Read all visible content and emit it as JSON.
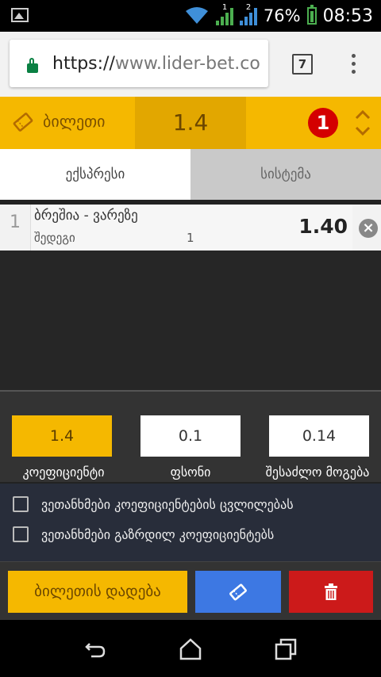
{
  "status_bar": {
    "battery_percent": "76%",
    "time": "08:53",
    "sim1_label": "1",
    "sim2_label": "2"
  },
  "browser": {
    "url_scheme": "https://",
    "url_rest": "www.lider-bet.co",
    "tab_count": "7"
  },
  "ticket": {
    "title": "ბილეთი",
    "total_coefficient": "1.4",
    "selection_count": "1"
  },
  "tabs": [
    {
      "label": "ექსპრესი",
      "active": true
    },
    {
      "label": "სისტემა",
      "active": false
    }
  ],
  "selections": [
    {
      "index": "1",
      "match": "ბრეშია - ვარეზე",
      "market": "შედეგი",
      "outcome": "1",
      "odds": "1.40"
    }
  ],
  "summary": {
    "coefficient_value": "1.4",
    "coefficient_label": "კოეფიციენტი",
    "stake_value": "0.1",
    "stake_label": "ფსონი",
    "win_value": "0.14",
    "win_label": "შესაძლო მოგება"
  },
  "options": [
    {
      "label": "ვეთანხმები კოეფიციენტების ცვლილებას",
      "checked": false
    },
    {
      "label": "ვეთანხმები გაზრდილ კოეფიციენტებს",
      "checked": false
    }
  ],
  "actions": {
    "place_bet_label": "ბილეთის დადება"
  },
  "colors": {
    "accent_yellow": "#f5b800",
    "save_blue": "#3d78e3",
    "delete_red": "#cc1a1a",
    "badge_red": "#d40000"
  },
  "icons": {
    "ticket": "ticket-icon",
    "save": "ticket-save-icon",
    "delete": "trash-icon",
    "lock": "lock-icon",
    "remove": "close-circle-icon"
  }
}
